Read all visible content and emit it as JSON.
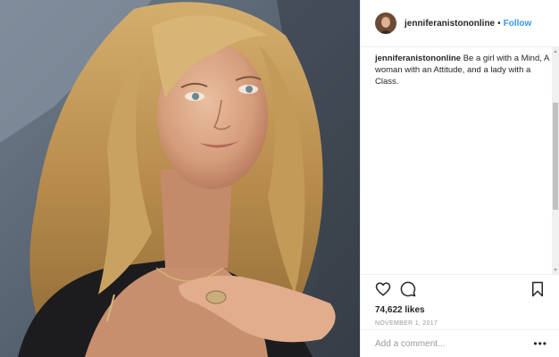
{
  "post": {
    "username": "jenniferanistononline",
    "separator": "•",
    "follow_label": "Follow",
    "caption_user": "jenniferanistononline",
    "caption_text": "Be a girl with a Mind, A woman with an Attitude, and a lady with a Class.",
    "likes": "74,622 likes",
    "date": "NOVEMBER 1, 2017",
    "comment_placeholder": "Add a comment...",
    "more_label": "•••"
  },
  "icons": {
    "like": "heart-icon",
    "comment": "comment-icon",
    "save": "bookmark-icon",
    "more": "more-options-icon"
  },
  "colors": {
    "follow_link": "#3897f0",
    "text": "#262626",
    "muted": "#999999",
    "divider": "#efefef"
  }
}
